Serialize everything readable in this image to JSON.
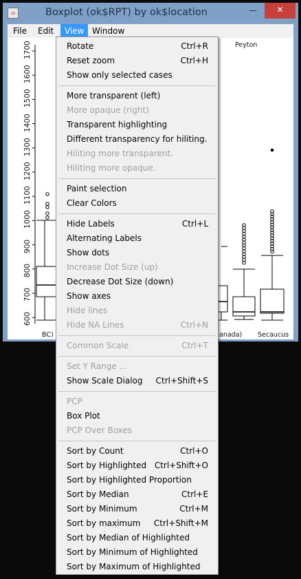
{
  "window": {
    "title": "Boxplot (ok$RPT) by ok$location",
    "app_icon_glyph": "☕",
    "controls": {
      "minimize": "—",
      "maximize": "□",
      "close": "✕"
    }
  },
  "menubar": {
    "file": "File",
    "edit": "Edit",
    "view": "View",
    "window": "Window"
  },
  "plot": {
    "y_ticks": [
      "1700",
      "1600",
      "1500",
      "1400",
      "1300",
      "1200",
      "1100",
      "1000",
      "900",
      "800",
      "700",
      "600"
    ],
    "top_label": "Peyton",
    "categories": [
      "BC)",
      "anada)",
      "Secaucus"
    ]
  },
  "view_menu": {
    "groups": [
      [
        {
          "label": "Rotate",
          "shortcut": "Ctrl+R",
          "enabled": true
        },
        {
          "label": "Reset zoom",
          "shortcut": "Ctrl+H",
          "enabled": true
        },
        {
          "label": "Show only selected cases",
          "shortcut": "",
          "enabled": true
        }
      ],
      [
        {
          "label": "More transparent (left)",
          "shortcut": "",
          "enabled": true
        },
        {
          "label": "More opaque (right)",
          "shortcut": "",
          "enabled": false
        },
        {
          "label": "Transparent highlighting",
          "shortcut": "",
          "enabled": true
        },
        {
          "label": "Different transparency for hiliting.",
          "shortcut": "",
          "enabled": true
        },
        {
          "label": "Hiliting more transparent.",
          "shortcut": "",
          "enabled": false
        },
        {
          "label": "Hiliting more opaque.",
          "shortcut": "",
          "enabled": false
        }
      ],
      [
        {
          "label": "Paint selection",
          "shortcut": "",
          "enabled": true
        },
        {
          "label": "Clear Colors",
          "shortcut": "",
          "enabled": true
        }
      ],
      [
        {
          "label": "Hide Labels",
          "shortcut": "Ctrl+L",
          "enabled": true
        },
        {
          "label": "Alternating Labels",
          "shortcut": "",
          "enabled": true
        },
        {
          "label": "Show dots",
          "shortcut": "",
          "enabled": true
        },
        {
          "label": "Increase Dot Size (up)",
          "shortcut": "",
          "enabled": false
        },
        {
          "label": "Decrease Dot Size (down)",
          "shortcut": "",
          "enabled": true
        },
        {
          "label": "Show axes",
          "shortcut": "",
          "enabled": true
        },
        {
          "label": "Hide lines",
          "shortcut": "",
          "enabled": false
        },
        {
          "label": "Hide NA Lines",
          "shortcut": "Ctrl+N",
          "enabled": false
        }
      ],
      [
        {
          "label": "Common Scale",
          "shortcut": "Ctrl+T",
          "enabled": false
        }
      ],
      [
        {
          "label": "Set Y Range ...",
          "shortcut": "",
          "enabled": false
        },
        {
          "label": "Show Scale Dialog",
          "shortcut": "Ctrl+Shift+S",
          "enabled": true
        }
      ],
      [
        {
          "label": "PCP",
          "shortcut": "",
          "enabled": false
        },
        {
          "label": "Box Plot",
          "shortcut": "",
          "enabled": true
        },
        {
          "label": "PCP Over Boxes",
          "shortcut": "",
          "enabled": false
        }
      ],
      [
        {
          "label": "Sort by Count",
          "shortcut": "Ctrl+O",
          "enabled": true
        },
        {
          "label": "Sort by Highlighted",
          "shortcut": "Ctrl+Shift+O",
          "enabled": true
        },
        {
          "label": "Sort by Highlighted Proportion",
          "shortcut": "",
          "enabled": true
        },
        {
          "label": "Sort by Median",
          "shortcut": "Ctrl+E",
          "enabled": true
        },
        {
          "label": "Sort by Minimum",
          "shortcut": "Ctrl+M",
          "enabled": true
        },
        {
          "label": "Sort by maximum",
          "shortcut": "Ctrl+Shift+M",
          "enabled": true
        },
        {
          "label": "Sort by Median of Highlighted",
          "shortcut": "",
          "enabled": true
        },
        {
          "label": "Sort by Minimum of Highlighted",
          "shortcut": "",
          "enabled": true
        },
        {
          "label": "Sort by Maximum of Highlighted",
          "shortcut": "",
          "enabled": true
        }
      ]
    ]
  }
}
